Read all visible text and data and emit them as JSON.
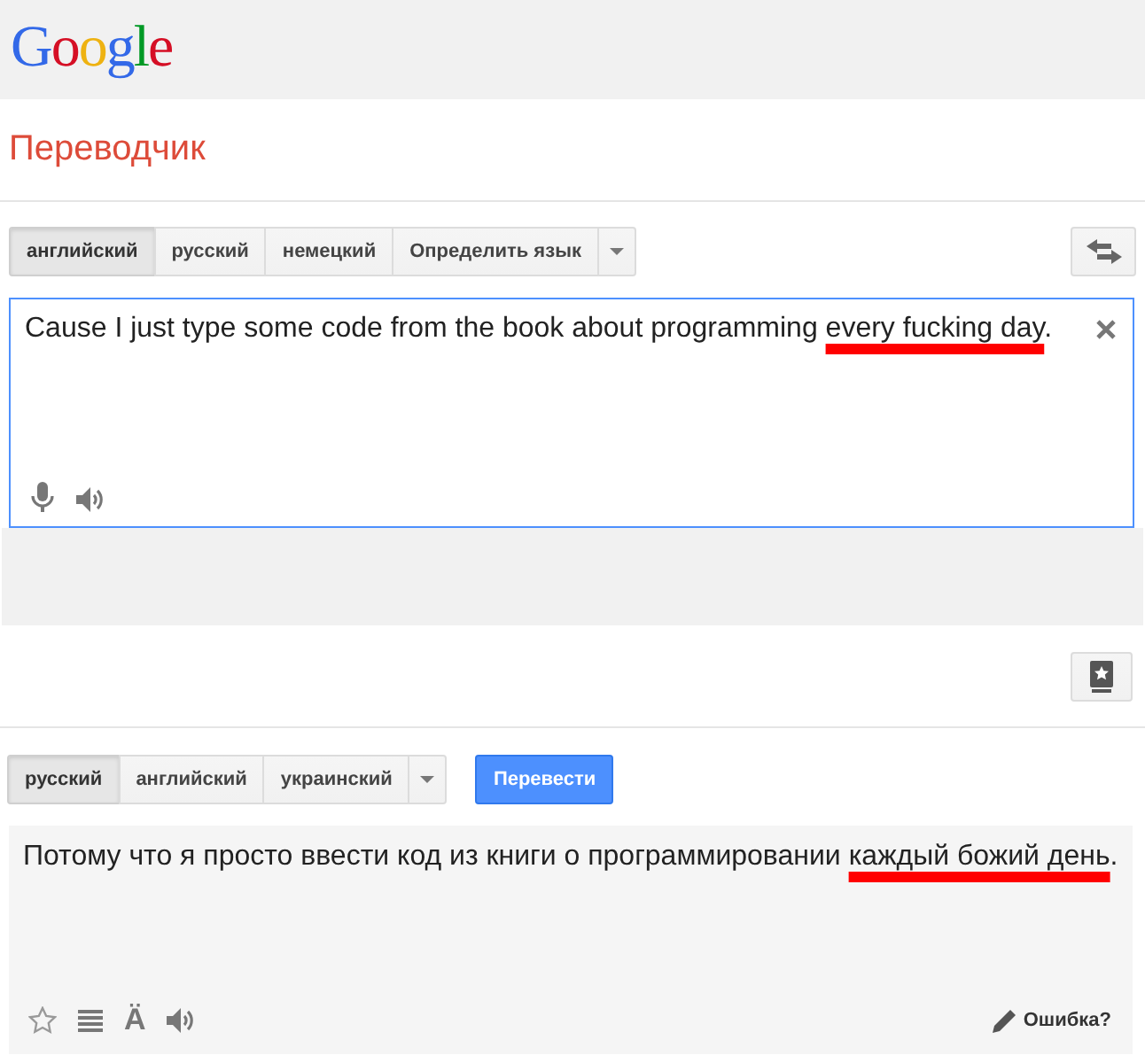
{
  "header": {
    "logo": "Google"
  },
  "title": "Переводчик",
  "source": {
    "languages": [
      {
        "label": "английский",
        "selected": true
      },
      {
        "label": "русский",
        "selected": false
      },
      {
        "label": "немецкий",
        "selected": false
      },
      {
        "label": "Определить язык",
        "selected": false
      }
    ],
    "text": [
      {
        "text": "Cause I just type some code from the book about programming ",
        "marked": false
      },
      {
        "text": "every fucking day",
        "marked": true
      },
      {
        "text": ".",
        "marked": false
      }
    ]
  },
  "target": {
    "languages": [
      {
        "label": "русский",
        "selected": true
      },
      {
        "label": "английский",
        "selected": false
      },
      {
        "label": "украинский",
        "selected": false
      }
    ],
    "translate_button": "Перевести",
    "text": [
      {
        "text": "Потому что я просто ввести код из книги о программировании ",
        "marked": false
      },
      {
        "text": "каждый божий день",
        "marked": true
      },
      {
        "text": ".",
        "marked": false
      }
    ],
    "transliteration": "Ä",
    "report_link": "Ошибка?"
  }
}
